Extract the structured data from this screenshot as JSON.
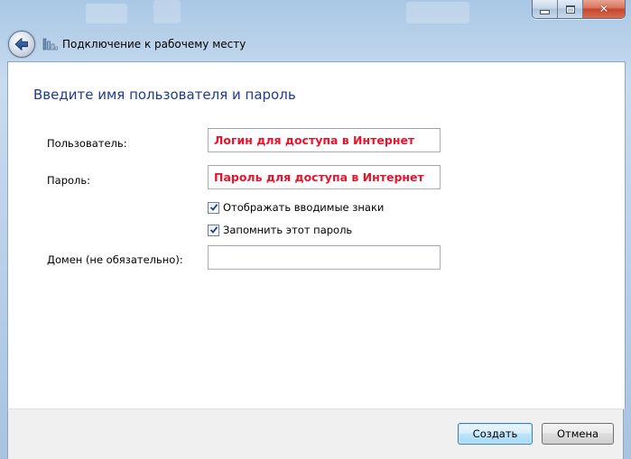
{
  "window": {
    "title": "Подключение к рабочему месту"
  },
  "form": {
    "heading": "Введите имя пользователя и пароль",
    "username_label": "Пользователь:",
    "username_value": "Логин для доступа в Интернет",
    "password_label": "Пароль:",
    "password_value": "Пароль для доступа в Интернет",
    "show_chars_label": "Отображать вводимые знаки",
    "show_chars_checked": true,
    "remember_label": "Запомнить этот пароль",
    "remember_checked": true,
    "domain_label": "Домен (не обязательно):",
    "domain_value": ""
  },
  "buttons": {
    "create_label": "Создать",
    "cancel_label": "Отмена"
  },
  "colors": {
    "heading": "#1e3c8c",
    "field_text": "#e8132c",
    "frame": "#b7cfe8"
  },
  "icons": {
    "back": "back-arrow-icon",
    "network": "network-connection-icon",
    "check": "checkmark-icon"
  }
}
